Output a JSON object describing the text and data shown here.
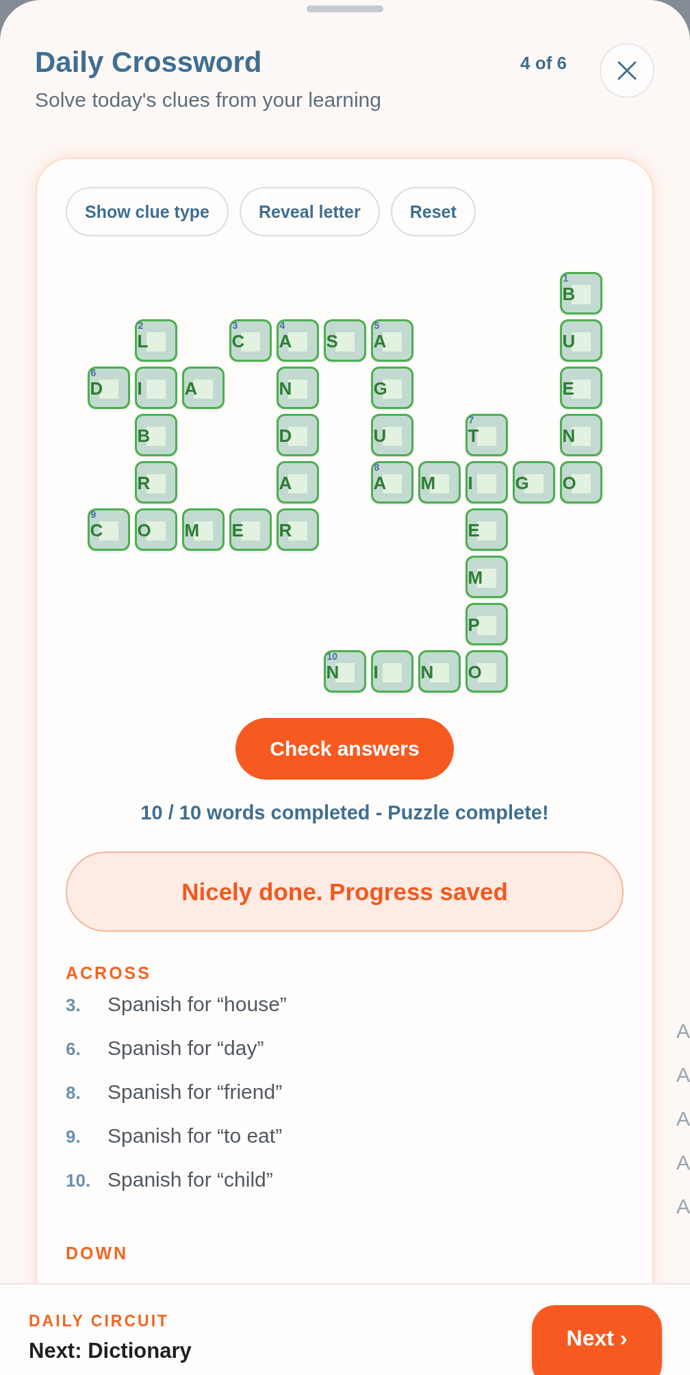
{
  "header": {
    "title": "Daily Crossword",
    "subtitle": "Solve today's clues from your learning",
    "counter": "4 of 6"
  },
  "tools": [
    "Show clue type",
    "Reveal letter",
    "Reset"
  ],
  "grid": {
    "rows": [
      [
        null,
        null,
        null,
        null,
        null,
        null,
        null,
        null,
        null,
        null,
        {
          "letter": "B",
          "number": "1",
          "correct": true
        }
      ],
      [
        null,
        {
          "letter": "L",
          "number": "2",
          "correct": true
        },
        null,
        {
          "letter": "C",
          "number": "3",
          "correct": true
        },
        {
          "letter": "A",
          "number": "4",
          "correct": true
        },
        {
          "letter": "S",
          "correct": true
        },
        {
          "letter": "A",
          "number": "5",
          "correct": true
        },
        null,
        null,
        null,
        {
          "letter": "U",
          "correct": true
        }
      ],
      [
        {
          "letter": "D",
          "number": "6",
          "correct": true
        },
        {
          "letter": "I",
          "correct": true
        },
        {
          "letter": "A",
          "correct": true
        },
        null,
        {
          "letter": "N",
          "correct": true
        },
        null,
        {
          "letter": "G",
          "correct": true
        },
        null,
        null,
        null,
        {
          "letter": "E",
          "correct": true
        }
      ],
      [
        null,
        {
          "letter": "B",
          "correct": true
        },
        null,
        null,
        {
          "letter": "D",
          "correct": true
        },
        null,
        {
          "letter": "U",
          "correct": true
        },
        null,
        {
          "letter": "T",
          "number": "7",
          "correct": true
        },
        null,
        {
          "letter": "N",
          "correct": true
        }
      ],
      [
        null,
        {
          "letter": "R",
          "correct": true
        },
        null,
        null,
        {
          "letter": "A",
          "correct": true
        },
        null,
        {
          "letter": "A",
          "number": "8",
          "correct": true
        },
        {
          "letter": "M",
          "correct": true
        },
        {
          "letter": "I",
          "correct": true
        },
        {
          "letter": "G",
          "correct": true
        },
        {
          "letter": "O",
          "correct": true
        }
      ],
      [
        {
          "letter": "C",
          "number": "9",
          "correct": true
        },
        {
          "letter": "O",
          "correct": true
        },
        {
          "letter": "M",
          "correct": true
        },
        {
          "letter": "E",
          "correct": true
        },
        {
          "letter": "R",
          "correct": true
        },
        null,
        null,
        null,
        {
          "letter": "E",
          "correct": true
        },
        null,
        null
      ],
      [
        null,
        null,
        null,
        null,
        null,
        null,
        null,
        null,
        {
          "letter": "M",
          "correct": true
        },
        null,
        null
      ],
      [
        null,
        null,
        null,
        null,
        null,
        null,
        null,
        null,
        {
          "letter": "P",
          "correct": true
        },
        null,
        null
      ],
      [
        null,
        null,
        null,
        null,
        null,
        {
          "letter": "N",
          "number": "10",
          "correct": true
        },
        {
          "letter": "I",
          "correct": true
        },
        {
          "letter": "N",
          "correct": true
        },
        {
          "letter": "O",
          "correct": true
        },
        null,
        null
      ]
    ]
  },
  "check_button": "Check answers",
  "progress": "10 / 10 words completed - Puzzle complete!",
  "message": "Nicely done. Progress saved",
  "clue_sections": [
    {
      "title": "ACROSS",
      "clues": [
        {
          "number": "3.",
          "text": "Spanish for “house”"
        },
        {
          "number": "6.",
          "text": "Spanish for “day”"
        },
        {
          "number": "8.",
          "text": "Spanish for “friend”"
        },
        {
          "number": "9.",
          "text": "Spanish for “to eat”"
        },
        {
          "number": "10.",
          "text": "Spanish for “child”"
        }
      ]
    },
    {
      "title": "DOWN"
    }
  ],
  "next_panel_peek": [
    "A",
    "A",
    "A",
    "A",
    "A"
  ],
  "footer": {
    "label": "DAILY CIRCUIT",
    "next": "Next: Dictionary",
    "button": "Next ›"
  }
}
